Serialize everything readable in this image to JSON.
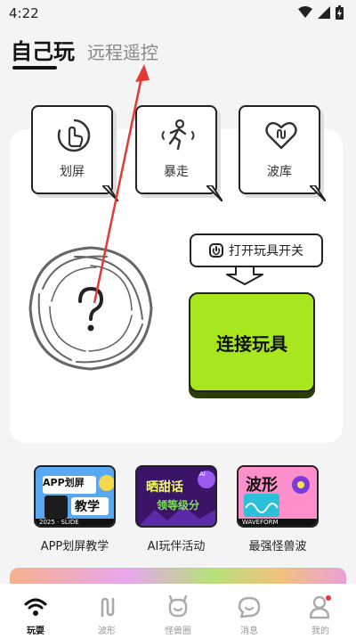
{
  "status_bar": {
    "time": "4:22"
  },
  "tabs": [
    {
      "label": "自己玩",
      "active": true
    },
    {
      "label": "远程遥控",
      "active": false
    }
  ],
  "modes": [
    {
      "label": "划屏",
      "icon": "swipe-hand-icon"
    },
    {
      "label": "暴走",
      "icon": "running-person-icon"
    },
    {
      "label": "波库",
      "icon": "heart-wave-icon"
    }
  ],
  "hint": {
    "text": "打开玩具开关",
    "icon": "power-icon"
  },
  "connect_button": {
    "label": "连接玩具"
  },
  "banners": [
    {
      "label": "APP划屏教学",
      "title_top": "APP划屏",
      "title_bottom": "教学",
      "tag": "2025 · SLIDE",
      "accent": "#3b8fe8"
    },
    {
      "label": "AI玩伴活动",
      "title_top": "晒甜话",
      "title_bottom": "领等级分",
      "tag": "AI",
      "accent": "#8a2be2"
    },
    {
      "label": "最强怪兽波",
      "title_top": "波形",
      "title_bottom": "",
      "tag": "WAVEFORM",
      "accent": "#ff3fa4"
    }
  ],
  "bottom_nav": [
    {
      "label": "玩耍",
      "icon": "wifi-signal-icon",
      "active": true
    },
    {
      "label": "波形",
      "icon": "wave-icon",
      "active": false
    },
    {
      "label": "怪兽圈",
      "icon": "monster-icon",
      "active": false
    },
    {
      "label": "消息",
      "icon": "chat-bubble-icon",
      "active": false
    },
    {
      "label": "我的",
      "icon": "profile-icon",
      "active": false,
      "badge": true
    }
  ],
  "colors": {
    "connect": "#a8e61e",
    "annotation_arrow": "#e53935"
  }
}
